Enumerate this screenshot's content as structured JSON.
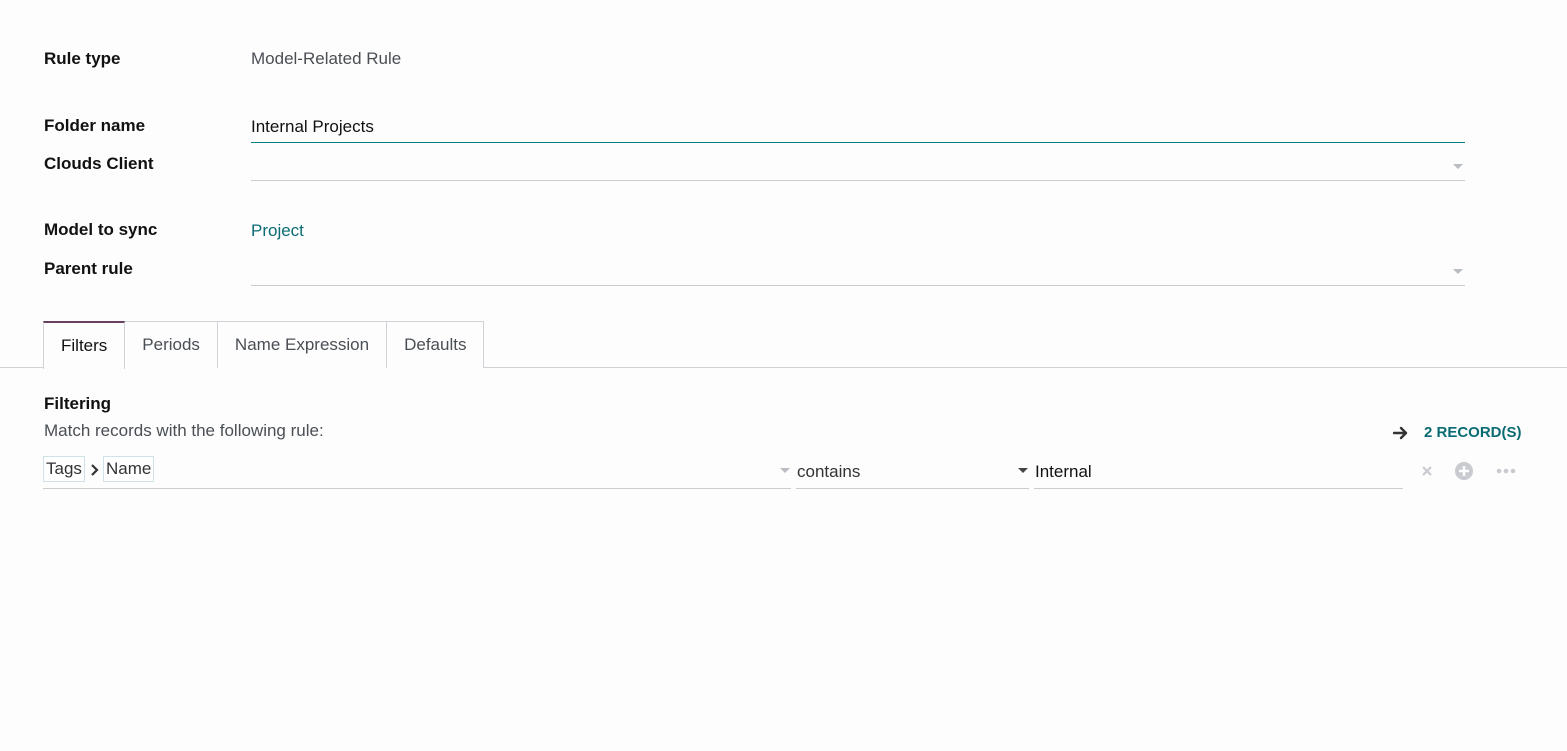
{
  "form": {
    "rule_type": {
      "label": "Rule type",
      "value": "Model-Related Rule"
    },
    "folder_name": {
      "label": "Folder name",
      "value": "Internal Projects"
    },
    "clouds_client": {
      "label": "Clouds Client",
      "value": ""
    },
    "model_to_sync": {
      "label": "Model to sync",
      "value": "Project"
    },
    "parent_rule": {
      "label": "Parent rule",
      "value": ""
    }
  },
  "tabs": [
    {
      "label": "Filters",
      "active": true
    },
    {
      "label": "Periods",
      "active": false
    },
    {
      "label": "Name Expression",
      "active": false
    },
    {
      "label": "Defaults",
      "active": false
    }
  ],
  "filtering": {
    "title": "Filtering",
    "subtitle": "Match records with the following rule:",
    "records_link": "2 RECORD(S)",
    "rule": {
      "path": [
        "Tags",
        "Name"
      ],
      "operator": "contains",
      "value": "Internal"
    }
  },
  "icons": {
    "arrow": "arrow-right-icon",
    "remove": "close-icon",
    "add": "plus-circle-icon",
    "more": "ellipsis-icon"
  },
  "colors": {
    "accent": "#017e84",
    "tab_active_border": "#6b3f62",
    "link": "#0a6b73"
  }
}
